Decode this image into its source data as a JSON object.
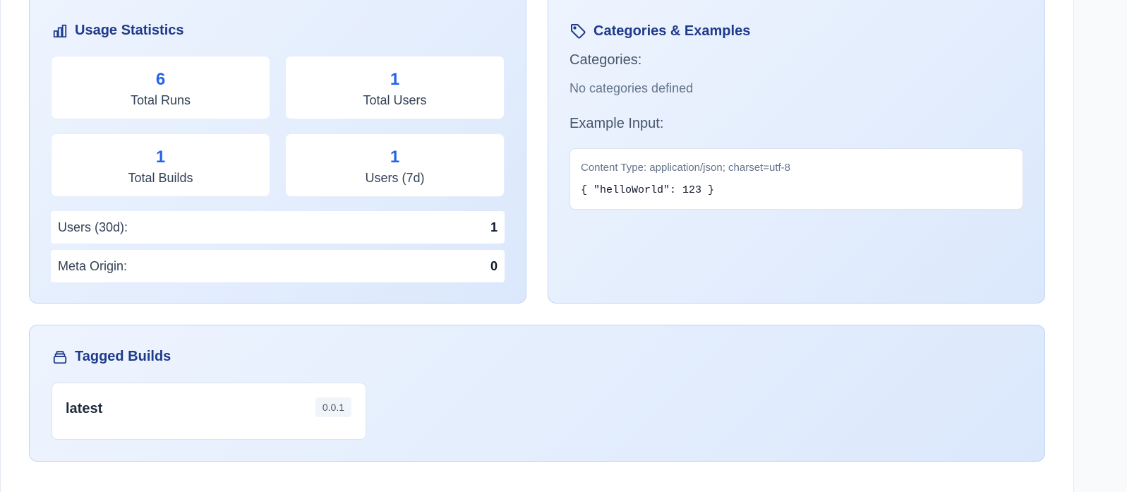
{
  "usage": {
    "title": "Usage Statistics",
    "icon": "bar-chart-icon",
    "stats": [
      {
        "value": "6",
        "label": "Total Runs"
      },
      {
        "value": "1",
        "label": "Total Users"
      },
      {
        "value": "1",
        "label": "Total Builds"
      },
      {
        "value": "1",
        "label": "Users (7d)"
      }
    ],
    "rows": [
      {
        "label": "Users (30d):",
        "value": "1"
      },
      {
        "label": "Meta Origin:",
        "value": "0"
      }
    ]
  },
  "categories": {
    "title": "Categories & Examples",
    "icon": "tag-icon",
    "categories_label": "Categories:",
    "categories_empty": "No categories defined",
    "example_label": "Example Input:",
    "content_type": "Content Type: application/json; charset=utf-8",
    "example_code": "{ \"helloWorld\": 123 }"
  },
  "tagged": {
    "title": "Tagged Builds",
    "icon": "layers-icon",
    "builds": [
      {
        "tag": "latest",
        "version": "0.0.1"
      }
    ]
  },
  "colors": {
    "accent": "#2563eb",
    "heading": "#1e3a8a",
    "panel_bg": "#e6effd",
    "panel_border": "#bfd5f6"
  }
}
